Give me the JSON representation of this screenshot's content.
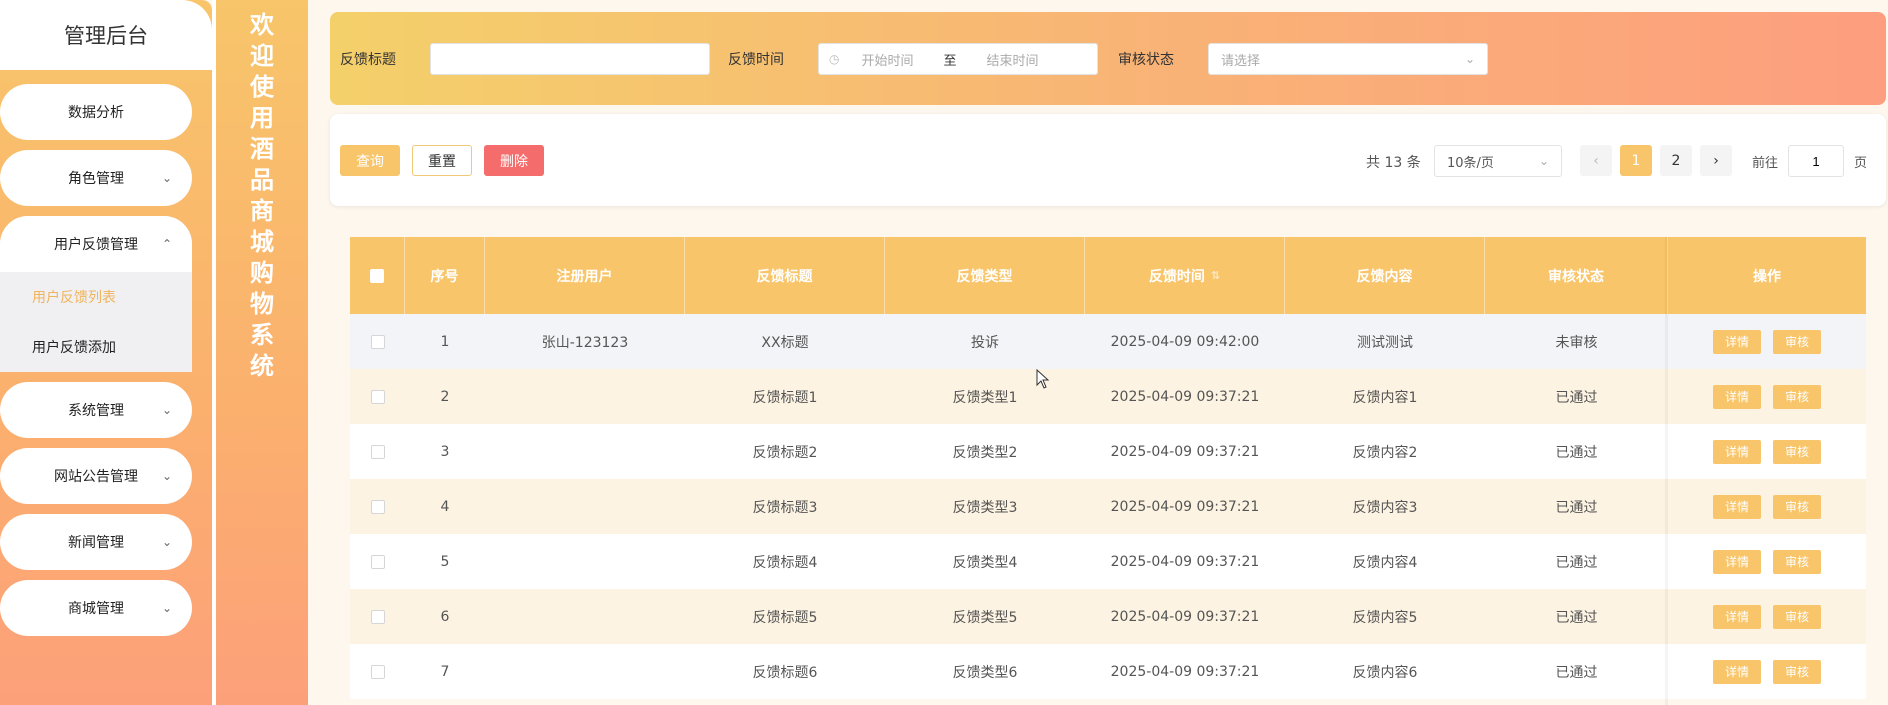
{
  "sidebar": {
    "title": "管理后台",
    "items": [
      {
        "label": "数据分析",
        "chevron": ""
      },
      {
        "label": "角色管理",
        "chevron": "⌄"
      },
      {
        "label": "用户反馈管理",
        "chevron": "⌃"
      },
      {
        "label": "系统管理",
        "chevron": "⌄"
      },
      {
        "label": "网站公告管理",
        "chevron": "⌄"
      },
      {
        "label": "新闻管理",
        "chevron": "⌄"
      },
      {
        "label": "商城管理",
        "chevron": "⌄"
      }
    ],
    "sub_items": [
      {
        "label": "用户反馈列表"
      },
      {
        "label": "用户反馈添加"
      }
    ]
  },
  "banner": {
    "chars": [
      "欢",
      "迎",
      "使",
      "用",
      "酒",
      "品",
      "商",
      "城",
      "购",
      "物",
      "系",
      "统"
    ]
  },
  "search": {
    "title_label": "反馈标题",
    "title_value": "",
    "time_label": "反馈时间",
    "start_placeholder": "开始时间",
    "range_sep": "至",
    "end_placeholder": "结束时间",
    "status_label": "审核状态",
    "status_placeholder": "请选择"
  },
  "actions": {
    "query": "查询",
    "reset": "重置",
    "delete": "删除"
  },
  "pagination": {
    "total": "共 13 条",
    "page_size": "10条/页",
    "pages": [
      "1",
      "2"
    ],
    "current": "1",
    "goto_label": "前往",
    "goto_value": "1",
    "page_suffix": "页"
  },
  "table": {
    "headers": [
      "序号",
      "注册用户",
      "反馈标题",
      "反馈类型",
      "反馈时间",
      "反馈内容",
      "审核状态",
      "操作"
    ],
    "sort_icon": "⇅",
    "detail_label": "详情",
    "review_label": "审核",
    "rows": [
      {
        "no": "1",
        "user": "张山-123123",
        "title": "XX标题",
        "type": "投诉",
        "time": "2025-04-09 09:42:00",
        "content": "测试测试",
        "status": "未审核"
      },
      {
        "no": "2",
        "user": "",
        "title": "反馈标题1",
        "type": "反馈类型1",
        "time": "2025-04-09 09:37:21",
        "content": "反馈内容1",
        "status": "已通过"
      },
      {
        "no": "3",
        "user": "",
        "title": "反馈标题2",
        "type": "反馈类型2",
        "time": "2025-04-09 09:37:21",
        "content": "反馈内容2",
        "status": "已通过"
      },
      {
        "no": "4",
        "user": "",
        "title": "反馈标题3",
        "type": "反馈类型3",
        "time": "2025-04-09 09:37:21",
        "content": "反馈内容3",
        "status": "已通过"
      },
      {
        "no": "5",
        "user": "",
        "title": "反馈标题4",
        "type": "反馈类型4",
        "time": "2025-04-09 09:37:21",
        "content": "反馈内容4",
        "status": "已通过"
      },
      {
        "no": "6",
        "user": "",
        "title": "反馈标题5",
        "type": "反馈类型5",
        "time": "2025-04-09 09:37:21",
        "content": "反馈内容5",
        "status": "已通过"
      },
      {
        "no": "7",
        "user": "",
        "title": "反馈标题6",
        "type": "反馈类型6",
        "time": "2025-04-09 09:37:21",
        "content": "反馈内容6",
        "status": "已通过"
      }
    ]
  },
  "colors": {
    "accent": "#f8c56a",
    "active_sub": "#f0b45c",
    "danger": "#f56c6c",
    "row_alt": "#fcf3e2",
    "row_first": "#f3f4f7"
  }
}
